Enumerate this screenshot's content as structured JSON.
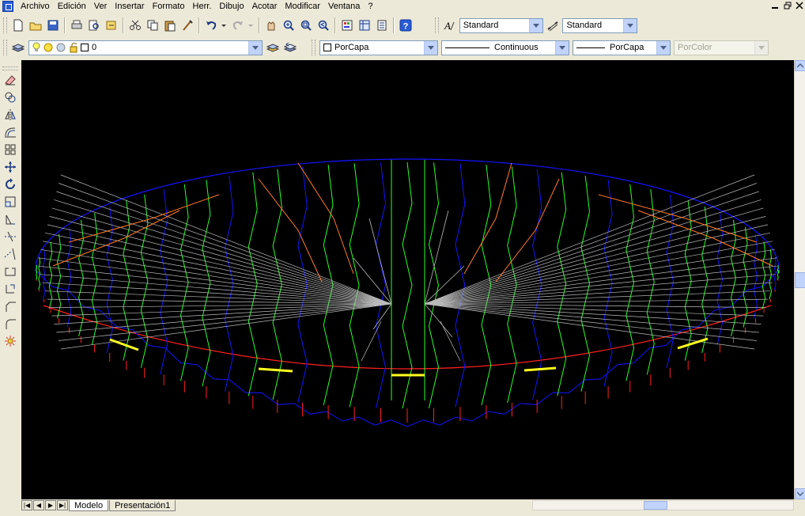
{
  "menu": {
    "items": [
      "Archivo",
      "Edición",
      "Ver",
      "Insertar",
      "Formato",
      "Herr.",
      "Dibujo",
      "Acotar",
      "Modificar",
      "Ventana",
      "?"
    ]
  },
  "styles_toolbar": {
    "text_style": "Standard",
    "dim_style": "Standard"
  },
  "layers_toolbar": {
    "current_layer": "0"
  },
  "properties_toolbar": {
    "color": "PorCapa",
    "linetype": "Continuous",
    "lineweight": "PorCapa",
    "plot_style": "PorColor"
  },
  "tabs": {
    "model": "Modelo",
    "layout": "Presentación1"
  },
  "colors": {
    "canvas_bg": "#000000",
    "outline_blue": "#1414ff",
    "outline_red": "#ff2020",
    "contour_green": "#2aff2a",
    "ridge_orange": "#ff7a2a",
    "mesh_grey": "#bbbbbb",
    "highlight_yellow": "#ffff20"
  }
}
